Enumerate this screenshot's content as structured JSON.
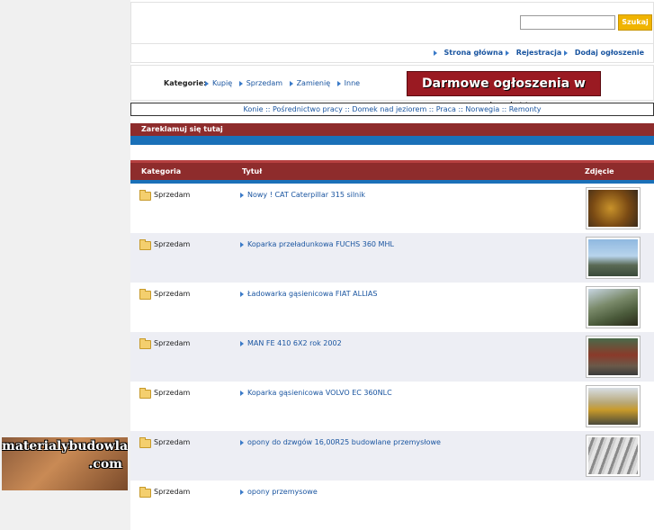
{
  "search": {
    "button_label": "Szukaj",
    "placeholder": ""
  },
  "nav": {
    "items": [
      {
        "label": "Strona główna"
      },
      {
        "label": "Rejestracja"
      },
      {
        "label": "Dodaj ogłoszenie"
      }
    ]
  },
  "categories": {
    "label": "Kategorie:",
    "items": [
      {
        "label": "Kupię"
      },
      {
        "label": "Sprzedam"
      },
      {
        "label": "Zamienię"
      },
      {
        "label": "Inne"
      }
    ]
  },
  "banner": {
    "text": "Darmowe ogłoszenia w sieci !!"
  },
  "links": {
    "items": [
      "Konie",
      "Pośrednictwo pracy",
      "Domek nad jeziorem",
      "Praca",
      "Norwegia",
      "Remonty"
    ],
    "separator": "::"
  },
  "ad_section": {
    "title": "Zareklamuj się tutaj"
  },
  "table": {
    "headers": {
      "category": "Kategoria",
      "title": "Tytuł",
      "photo": "Zdjęcie"
    },
    "rows": [
      {
        "category": "Sprzedam",
        "title": "Nowy ! CAT Caterpillar 315 silnik",
        "thumb_icon": "engine-photo"
      },
      {
        "category": "Sprzedam",
        "title": "Koparka przeładunkowa FUCHS 360 MHL",
        "thumb_icon": "excavator-photo"
      },
      {
        "category": "Sprzedam",
        "title": "Ładowarka gąsienicowa FIAT ALLIAS",
        "thumb_icon": "crawler-loader-photo"
      },
      {
        "category": "Sprzedam",
        "title": "MAN FE 410 6X2 rok 2002",
        "thumb_icon": "truck-crane-photo"
      },
      {
        "category": "Sprzedam",
        "title": "Koparka gąsienicowa VOLVO EC 360NLC",
        "thumb_icon": "volvo-excavator-photo"
      },
      {
        "category": "Sprzedam",
        "title": "opony do dzwgów 16,00R25 budowlane przemysłowe",
        "thumb_icon": "tire-photo"
      },
      {
        "category": "Sprzedam",
        "title": "opony przemysowe",
        "thumb_icon": ""
      }
    ]
  },
  "left_ad": {
    "line1": "materialybudowlane",
    "line2": ".com"
  }
}
